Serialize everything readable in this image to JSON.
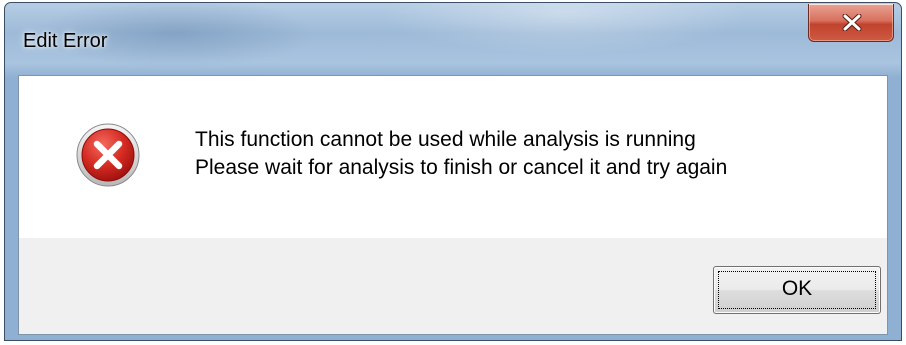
{
  "window": {
    "title": "Edit Error"
  },
  "icons": {
    "close": "close-icon",
    "error": "error-icon"
  },
  "message": {
    "line1": "This function cannot be used while analysis is running",
    "line2": "Please wait for analysis to finish or cancel it and try again"
  },
  "buttons": {
    "ok_label": "OK"
  },
  "colors": {
    "close_button": "#c7442e",
    "error_icon": "#c4181b",
    "titlebar": "#a3c0dd"
  }
}
